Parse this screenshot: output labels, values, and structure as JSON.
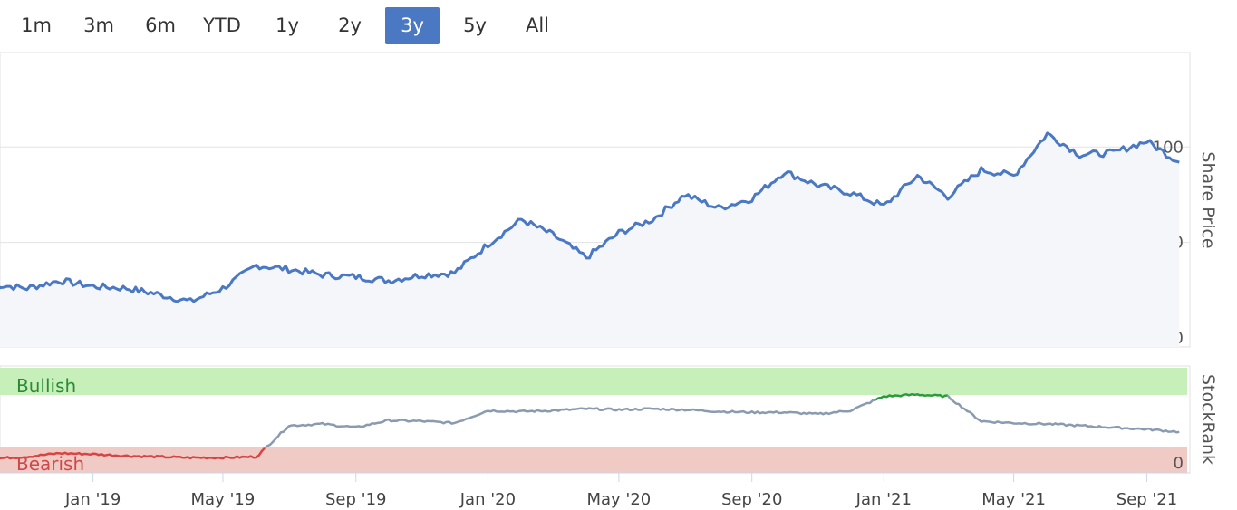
{
  "range_selector": {
    "buttons": [
      {
        "label": "1m"
      },
      {
        "label": "3m"
      },
      {
        "label": "6m"
      },
      {
        "label": "YTD"
      },
      {
        "label": "1y"
      },
      {
        "label": "2y"
      },
      {
        "label": "3y",
        "active": true
      },
      {
        "label": "5y"
      },
      {
        "label": "All"
      }
    ]
  },
  "colors": {
    "price_line": "#4a78c2",
    "price_fill": "#f4f6fa",
    "rank_line": "#8a9bb0",
    "bullish_line": "#2c9a3a",
    "bearish_line": "#d64545",
    "bullish_band": "#c6efb9",
    "bearish_band": "#f0cac5",
    "bullish_text": "#2c8a35",
    "bearish_text": "#d04848",
    "accent": "#4a78c2"
  },
  "chart_data": [
    {
      "type": "line",
      "ylabel": "Share Price",
      "ylim": [
        0,
        140
      ],
      "yticks": [
        "0",
        "50",
        "100"
      ],
      "x": [
        "2018-10-01",
        "2018-11-01",
        "2018-12-01",
        "2019-01-01",
        "2019-02-01",
        "2019-03-01",
        "2019-04-01",
        "2019-05-01",
        "2019-06-01",
        "2019-07-01",
        "2019-08-01",
        "2019-09-01",
        "2019-10-01",
        "2019-11-01",
        "2019-12-01",
        "2020-01-01",
        "2020-02-01",
        "2020-03-01",
        "2020-04-01",
        "2020-05-01",
        "2020-06-01",
        "2020-07-01",
        "2020-08-01",
        "2020-09-01",
        "2020-10-01",
        "2020-11-01",
        "2020-12-01",
        "2021-01-01",
        "2021-02-01",
        "2021-03-01",
        "2021-04-01",
        "2021-05-01",
        "2021-06-01",
        "2021-07-01",
        "2021-08-01",
        "2021-09-01",
        "2021-10-01"
      ],
      "series": [
        {
          "values": [
            28,
            26,
            30,
            27,
            26,
            23,
            19,
            26,
            38,
            36,
            33,
            32,
            30,
            33,
            34,
            49,
            62,
            54,
            42,
            55,
            62,
            75,
            68,
            73,
            87,
            80,
            76,
            69,
            85,
            74,
            88,
            85,
            107,
            96,
            97,
            103,
            92
          ]
        }
      ]
    },
    {
      "type": "line",
      "ylabel": "StockRank",
      "ylim": [
        0,
        100
      ],
      "yticks": [
        "0"
      ],
      "band_labels": [
        "Bullish",
        "Bearish"
      ],
      "xticks": [
        "Jan '19",
        "May '19",
        "Sep '19",
        "Jan '20",
        "May '20",
        "Sep '20",
        "Jan '21",
        "May '21",
        "Sep '21"
      ],
      "x": [
        "2018-10-01",
        "2018-11-01",
        "2018-12-01",
        "2019-01-01",
        "2019-02-01",
        "2019-03-01",
        "2019-04-01",
        "2019-05-01",
        "2019-06-01",
        "2019-07-01",
        "2019-08-01",
        "2019-09-01",
        "2019-10-01",
        "2019-11-01",
        "2019-12-01",
        "2020-01-01",
        "2020-02-01",
        "2020-03-01",
        "2020-04-01",
        "2020-05-01",
        "2020-06-01",
        "2020-07-01",
        "2020-08-01",
        "2020-09-01",
        "2020-10-01",
        "2020-11-01",
        "2020-12-01",
        "2021-01-01",
        "2021-02-01",
        "2021-03-01",
        "2021-04-01",
        "2021-05-01",
        "2021-06-01",
        "2021-07-01",
        "2021-08-01",
        "2021-09-01",
        "2021-10-01"
      ],
      "series": [
        {
          "values": [
            8,
            10,
            14,
            13,
            11,
            10,
            9,
            9,
            10,
            45,
            47,
            43,
            51,
            50,
            48,
            62,
            61,
            62,
            64,
            63,
            64,
            63,
            61,
            60,
            60,
            58,
            62,
            78,
            80,
            78,
            50,
            48,
            47,
            45,
            43,
            41,
            38
          ]
        }
      ]
    }
  ]
}
